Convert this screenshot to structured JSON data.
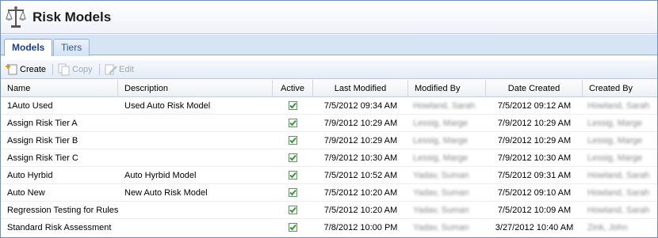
{
  "window": {
    "title": "Risk Models",
    "icon": "scales-icon"
  },
  "tabs": [
    {
      "label": "Models",
      "active": true
    },
    {
      "label": "Tiers",
      "active": false
    }
  ],
  "toolbar": {
    "create_label": "Create",
    "copy_label": "Copy",
    "edit_label": "Edit",
    "create_icon": "create-icon",
    "copy_icon": "copy-icon",
    "edit_icon": "edit-icon"
  },
  "columns": {
    "name": "Name",
    "description": "Description",
    "active": "Active",
    "last_modified": "Last Modified",
    "modified_by": "Modified By",
    "date_created": "Date Created",
    "created_by": "Created By"
  },
  "rows": [
    {
      "name": "1Auto Used",
      "description": "Used Auto Risk Model",
      "active": true,
      "last_modified": "7/5/2012 09:34 AM",
      "modified_by": "Howland, Sarah",
      "date_created": "7/5/2012 09:12 AM",
      "created_by": "Howland, Sarah"
    },
    {
      "name": "Assign Risk Tier A",
      "description": "",
      "active": true,
      "last_modified": "7/9/2012 10:29 AM",
      "modified_by": "Lessig, Marge",
      "date_created": "7/9/2012 10:29 AM",
      "created_by": "Lessig, Marge"
    },
    {
      "name": "Assign Risk Tier B",
      "description": "",
      "active": true,
      "last_modified": "7/9/2012 10:29 AM",
      "modified_by": "Lessig, Marge",
      "date_created": "7/9/2012 10:29 AM",
      "created_by": "Lessig, Marge"
    },
    {
      "name": "Assign Risk Tier C",
      "description": "",
      "active": true,
      "last_modified": "7/9/2012 10:30 AM",
      "modified_by": "Lessig, Marge",
      "date_created": "7/9/2012 10:30 AM",
      "created_by": "Lessig, Marge"
    },
    {
      "name": "Auto Hyrbid",
      "description": "Auto Hyrbid Model",
      "active": true,
      "last_modified": "7/5/2012 10:52 AM",
      "modified_by": "Yadav, Suman",
      "date_created": "7/5/2012 09:31 AM",
      "created_by": "Howland, Sarah"
    },
    {
      "name": "Auto New",
      "description": "New Auto Risk Model",
      "active": true,
      "last_modified": "7/5/2012 10:20 AM",
      "modified_by": "Yadav, Suman",
      "date_created": "7/5/2012 09:10 AM",
      "created_by": "Howland, Sarah"
    },
    {
      "name": "Regression Testing for Rules",
      "description": "",
      "active": true,
      "last_modified": "7/5/2012 10:20 AM",
      "modified_by": "Yadav, Suman",
      "date_created": "7/5/2012 10:09 AM",
      "created_by": "Howland, Sarah"
    },
    {
      "name": "Standard Risk Assessment",
      "description": "",
      "active": true,
      "last_modified": "7/8/2012 10:00 PM",
      "modified_by": "Yadav, Suman",
      "date_created": "3/27/2012 10:40 AM",
      "created_by": "Zink, John"
    }
  ],
  "colors": {
    "accent": "#15428b",
    "check": "#2e9d2e",
    "tabstrip": "#d7e4f3"
  }
}
